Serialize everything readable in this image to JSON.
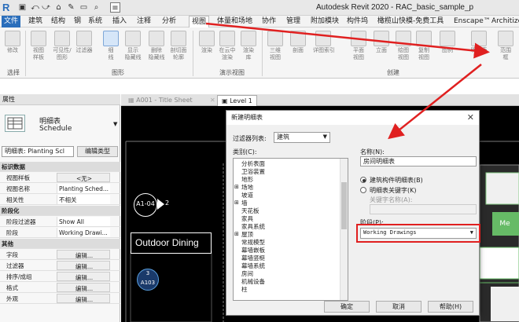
{
  "app": {
    "logo": "R",
    "title": "Autodesk Revit 2020 - RAC_basic_sample_p"
  },
  "quick_access": [
    "▣",
    "⤺",
    "⤻",
    "⌂",
    "✎",
    "▭",
    "⌕",
    "≡"
  ],
  "menu_tabs": [
    "文件",
    "建筑",
    "结构",
    "钢",
    "系统",
    "插入",
    "注释",
    "分析",
    "视图",
    "体量和场地",
    "协作",
    "管理",
    "附加模块",
    "构件坞",
    "橄榄山快模-免费工具",
    "Enscape™",
    "Architizer"
  ],
  "ribbon": {
    "buttons": [
      {
        "label": "修改"
      },
      {
        "label": "视图\n样板"
      },
      {
        "label": "可见性/\n图形"
      },
      {
        "label": "过滤器"
      },
      {
        "label": "细\n线"
      },
      {
        "label": "显示\n隐藏线"
      },
      {
        "label": "删除\n隐藏线"
      },
      {
        "label": "剖切面\n轮廓"
      },
      {
        "label": "渲染"
      },
      {
        "label": "在云中\n渲染"
      },
      {
        "label": "渲染\n库"
      },
      {
        "label": "三维\n视图"
      },
      {
        "label": "剖面"
      },
      {
        "label": "详图索引"
      },
      {
        "label": "平面\n视图"
      },
      {
        "label": "立面"
      },
      {
        "label": "绘图\n视图"
      },
      {
        "label": "复制\n视图"
      },
      {
        "label": "图例"
      },
      {
        "label": "明细表"
      },
      {
        "label": "范围\n框"
      }
    ],
    "groups": [
      "选择",
      "图形",
      "演示视图",
      "创建"
    ]
  },
  "properties": {
    "header": "属性",
    "type_name": "明细表",
    "type_sub": "Schedule",
    "selector": "明细表: Planting Scl",
    "edit_type": "编辑类型",
    "rows": [
      {
        "section": "标识数据"
      },
      {
        "k": "视图样板",
        "v": "<无>",
        "btn": true
      },
      {
        "k": "视图名称",
        "v": "Planting Sched..."
      },
      {
        "k": "相关性",
        "v": "不相关"
      },
      {
        "section": "阶段化"
      },
      {
        "k": "阶段过滤器",
        "v": "Show All"
      },
      {
        "k": "阶段",
        "v": "Working Drawi..."
      },
      {
        "section": "其他"
      },
      {
        "k": "字段",
        "v": "编辑...",
        "btn": true
      },
      {
        "k": "过滤器",
        "v": "编辑...",
        "btn": true
      },
      {
        "k": "排序/成组",
        "v": "编辑...",
        "btn": true
      },
      {
        "k": "格式",
        "v": "编辑...",
        "btn": true
      },
      {
        "k": "外观",
        "v": "编辑...",
        "btn": true
      }
    ]
  },
  "view_tabs": [
    "A001 - Title Sheet",
    "Level 1"
  ],
  "canvas": {
    "tag1": "A1-04",
    "tag1_num": "2",
    "room_label": "Outdoor Dining",
    "tag2_top": "3",
    "tag2_bottom": "A103",
    "right_label": "Me"
  },
  "dialog": {
    "title": "新建明细表",
    "filter_label": "过滤器列表:",
    "filter_value": "建筑",
    "category_label": "类别(C):",
    "categories": [
      {
        "t": "分析表面",
        "exp": false
      },
      {
        "t": "卫浴装置",
        "exp": false
      },
      {
        "t": "地形",
        "exp": false
      },
      {
        "t": "场地",
        "exp": true
      },
      {
        "t": "坡道",
        "exp": false
      },
      {
        "t": "墙",
        "exp": true
      },
      {
        "t": "天花板",
        "exp": false
      },
      {
        "t": "家具",
        "exp": false
      },
      {
        "t": "家具系统",
        "exp": false
      },
      {
        "t": "屋顶",
        "exp": true
      },
      {
        "t": "常规模型",
        "exp": false
      },
      {
        "t": "幕墙嵌板",
        "exp": false
      },
      {
        "t": "幕墙竖梃",
        "exp": false
      },
      {
        "t": "幕墙系统",
        "exp": false
      },
      {
        "t": "房间",
        "exp": false
      },
      {
        "t": "机械设备",
        "exp": false
      },
      {
        "t": "柱",
        "exp": false
      }
    ],
    "name_label": "名称(N):",
    "name_value": "房间明细表",
    "radio1": "建筑构件明细表(B)",
    "radio2": "明细表关键字(K)",
    "key_name_label": "关键字名称(A):",
    "phase_label": "阶段(P):",
    "phase_value": "Working Drawings",
    "ok": "确定",
    "cancel": "取消",
    "help": "帮助(H)"
  },
  "colors": {
    "accent": "#2a6ebb",
    "arrow": "#e02020",
    "canvas": "#000000"
  }
}
